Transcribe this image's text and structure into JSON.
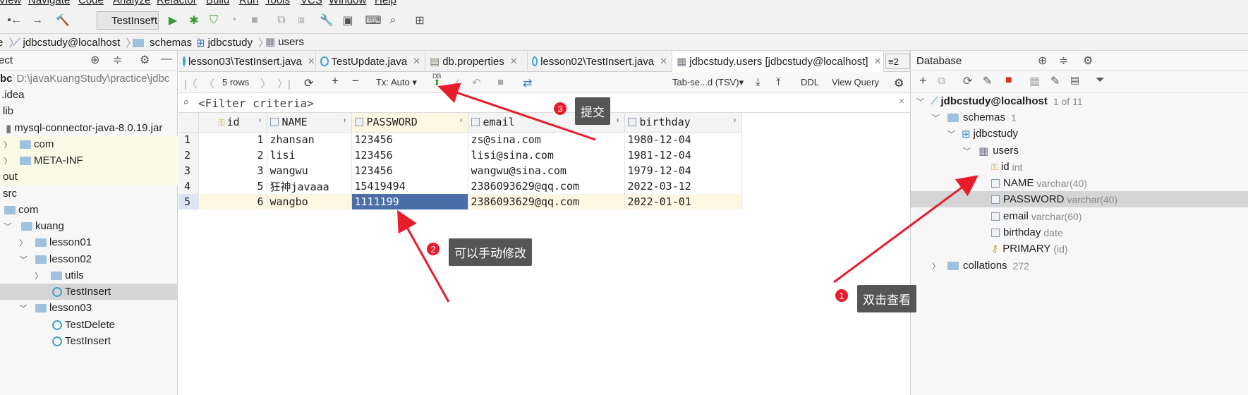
{
  "menu": [
    "View",
    "Navigate",
    "Code",
    "Analyze",
    "Refactor",
    "Build",
    "Run",
    "Tools",
    "VCS",
    "Window",
    "Help"
  ],
  "toolbar": {
    "run_config": "TestInsert"
  },
  "breadcrumb": {
    "datasource": "jdbcstudy@localhost",
    "schemas": "schemas",
    "schema": "jdbcstudy",
    "table": "users"
  },
  "project": {
    "header": "ect",
    "root_label": "bc",
    "root_path": "D:\\javaKuangStudy\\practice\\jdbc",
    "items": [
      ".idea",
      "lib",
      "mysql-connector-java-8.0.19.jar",
      "com",
      "META-INF",
      "out",
      "src",
      "com",
      "kuang",
      "lesson01",
      "lesson02",
      "utils",
      "TestInsert",
      "lesson03",
      "TestDelete",
      "TestInsert"
    ]
  },
  "tabs": [
    "lesson03\\TestInsert.java",
    "TestUpdate.java",
    "db.properties",
    "lesson02\\TestInsert.java",
    "jdbcstudy.users [jdbcstudy@localhost]"
  ],
  "tabs_more": "2",
  "grid_toolbar": {
    "rows": "5 rows",
    "tx": "Tx: Auto",
    "db_label": "DB",
    "export_format": "Tab-se...d (TSV)",
    "ddl": "DDL",
    "view_query": "View Query"
  },
  "filter": {
    "placeholder": "<Filter criteria>"
  },
  "table": {
    "columns": [
      "id",
      "NAME",
      "PASSWORD",
      "email",
      "birthday"
    ],
    "rows": [
      {
        "rn": "1",
        "id": "1",
        "name": "zhansan",
        "password": "123456",
        "email": "zs@sina.com",
        "birthday": "1980-12-04"
      },
      {
        "rn": "2",
        "id": "2",
        "name": "lisi",
        "password": "123456",
        "email": "lisi@sina.com",
        "birthday": "1981-12-04"
      },
      {
        "rn": "3",
        "id": "3",
        "name": "wangwu",
        "password": "123456",
        "email": "wangwu@sina.com",
        "birthday": "1979-12-04"
      },
      {
        "rn": "4",
        "id": "5",
        "name": "狂神javaaa",
        "password": "15419494",
        "email": "2386093629@qq.com",
        "birthday": "2022-03-12"
      },
      {
        "rn": "5",
        "id": "6",
        "name": "wangbo",
        "password": "1111199",
        "email": "2386093629@qq.com",
        "birthday": "2022-01-01"
      }
    ]
  },
  "database": {
    "title": "Database",
    "datasource": "jdbcstudy@localhost",
    "datasource_count": "1 of 11",
    "schemas": "schemas",
    "schemas_count": "1",
    "schema": "jdbcstudy",
    "table": "users",
    "columns": [
      {
        "name": "id",
        "type": "int"
      },
      {
        "name": "NAME",
        "type": "varchar(40)"
      },
      {
        "name": "PASSWORD",
        "type": "varchar(40)"
      },
      {
        "name": "email",
        "type": "varchar(60)"
      },
      {
        "name": "birthday",
        "type": "date"
      }
    ],
    "key": {
      "name": "PRIMARY",
      "type": "(id)"
    },
    "collations": "collations",
    "collations_count": "272"
  },
  "annotations": [
    {
      "num": "1",
      "text": "双击查看"
    },
    {
      "num": "2",
      "text": "可以手动修改"
    },
    {
      "num": "3",
      "text": "提交"
    }
  ],
  "colors": {
    "accent_red": "#e81c2a",
    "selection": "#4b6ea9",
    "callout_bg": "#555555"
  }
}
